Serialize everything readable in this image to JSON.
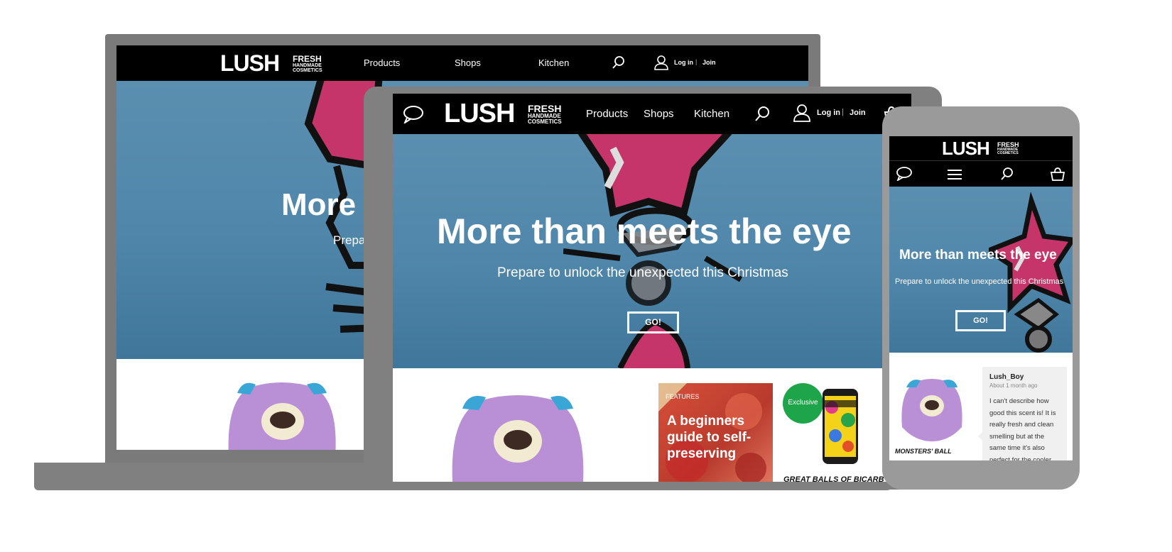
{
  "brand": {
    "logo": "LUSH",
    "tagline_1": "FRESH",
    "tagline_2": "HANDMADE",
    "tagline_3": "COSMETICS"
  },
  "nav": {
    "products": "Products",
    "shops": "Shops",
    "kitchen": "Kitchen",
    "login": "Log in",
    "separator": "|",
    "join": "Join"
  },
  "hero": {
    "title": "More than meets the eye",
    "title_partial": "More",
    "subtitle": "Prepare to unlock the unexpected this Christmas",
    "subtitle_partial": "Prepa",
    "cta": "GO!"
  },
  "feature": {
    "tag": "FEATURES",
    "headline": "A beginners guide to self-preserving"
  },
  "exclusive": {
    "badge": "Exclusive",
    "product_name": "GREAT BALLS OF BICARB"
  },
  "review": {
    "product_name": "MONSTERS' BALL",
    "author": "Lush_Boy",
    "time": "About 1 month ago",
    "text": "I can't describe how good this scent is! It is really fresh and clean smelling but at the same time it's also perfect for the cooler"
  },
  "icons": [
    "chat-icon",
    "search-icon",
    "user-icon",
    "basket-icon",
    "menu-icon"
  ],
  "colors": {
    "nav_bg": "#000000",
    "hero_blue": "#4f86aa",
    "star_pink": "#c6356a",
    "bomb_purple": "#b98fd6",
    "exclusive_green": "#1ea54a",
    "device_gray": "#7a7a7a"
  }
}
